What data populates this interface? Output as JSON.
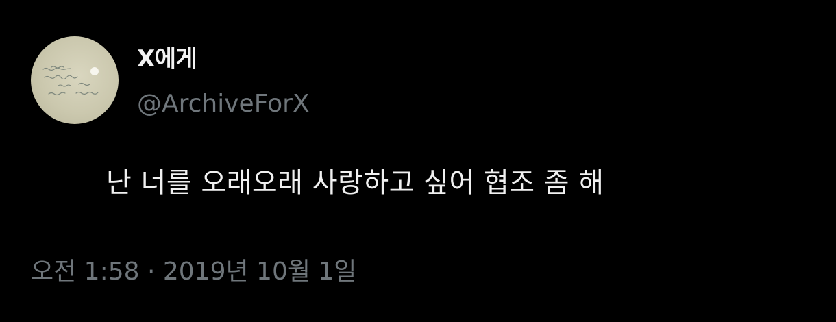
{
  "tweet": {
    "author": {
      "display_name": "X에게",
      "handle": "@ArchiveForX",
      "avatar_icon": "handwritten-note-avatar"
    },
    "text": "난 너를 오래오래 사랑하고 싶어 협조 좀 해",
    "timestamp": "오전 1:58 · 2019년 10월 1일"
  },
  "colors": {
    "background": "#000000",
    "primary_text": "#f0f0f0",
    "secondary_text": "#6f767b",
    "avatar_paper": "#cbc8ae"
  }
}
